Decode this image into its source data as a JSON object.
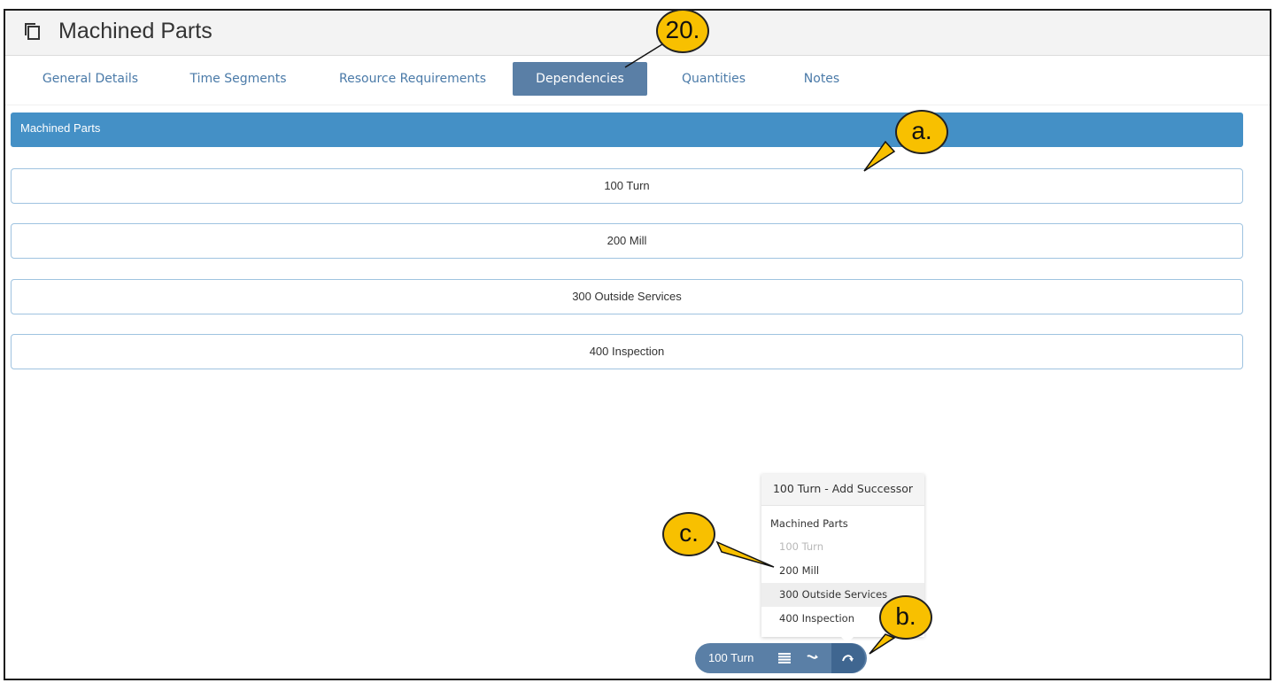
{
  "header": {
    "title": "Machined Parts",
    "icon": "copy-icon"
  },
  "tabs": [
    {
      "label": "General Details"
    },
    {
      "label": "Time Segments"
    },
    {
      "label": "Resource Requirements"
    },
    {
      "label": "Dependencies",
      "active": true
    },
    {
      "label": "Quantities"
    },
    {
      "label": "Notes"
    }
  ],
  "section": {
    "title": "Machined Parts"
  },
  "operations": [
    {
      "label": "100 Turn"
    },
    {
      "label": "200 Mill"
    },
    {
      "label": "300 Outside Services"
    },
    {
      "label": "400 Inspection"
    }
  ],
  "popup": {
    "title": "100 Turn - Add Successor",
    "group": "Machined Parts",
    "options": [
      {
        "label": "100 Turn",
        "state": "disabled"
      },
      {
        "label": "200 Mill",
        "state": "normal"
      },
      {
        "label": "300 Outside Services",
        "state": "hover"
      },
      {
        "label": "400 Inspection",
        "state": "normal"
      }
    ]
  },
  "toolbar": {
    "label": "100 Turn",
    "buttons": [
      {
        "icon": "list-icon"
      },
      {
        "icon": "predecessor-arrow-icon"
      },
      {
        "icon": "successor-arrow-icon",
        "active": true
      }
    ]
  },
  "callouts": {
    "step": "20.",
    "a": "a.",
    "b": "b.",
    "c": "c."
  },
  "colors": {
    "accent": "#4490c6",
    "tab_active": "#5a7fa6",
    "tab_text": "#4a7aa8",
    "callout": "#f8c000"
  }
}
